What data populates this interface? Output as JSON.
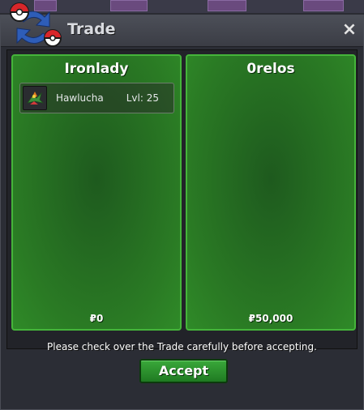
{
  "window": {
    "title": "Trade",
    "close_label": "×"
  },
  "left_panel": {
    "player_name": "Ironlady",
    "money": "₽0",
    "items": [
      {
        "pokemon_name": "Hawlucha",
        "level": "Lvl: 25"
      }
    ]
  },
  "right_panel": {
    "player_name": "0relos",
    "money": "₽50,000",
    "items": []
  },
  "footer": {
    "notice": "Please check over the Trade carefully before accepting.",
    "accept_label": "Accept"
  },
  "icons": {
    "logo": "pokeball-arrows-icon",
    "close": "close-icon",
    "item": "hawlucha-icon"
  },
  "colors": {
    "panel_green": "#2a7a24",
    "panel_border": "#45b43a",
    "button_green": "#2e9a30",
    "window_bg": "#2b2d35"
  }
}
